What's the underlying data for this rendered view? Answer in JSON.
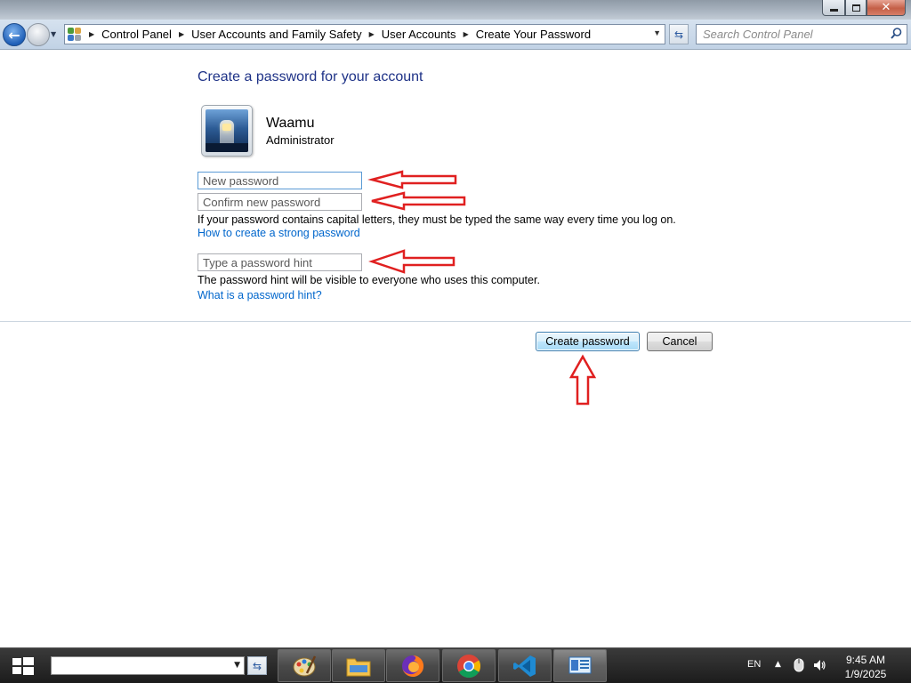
{
  "window": {
    "minimize_icon": "minimize-icon",
    "maximize_icon": "maximize-icon",
    "close_glyph": "✕"
  },
  "nav": {
    "breadcrumbs": [
      "Control Panel",
      "User Accounts and Family Safety",
      "User Accounts",
      "Create Your Password"
    ],
    "search_placeholder": "Search Control Panel"
  },
  "page": {
    "heading": "Create a password for your account",
    "user": {
      "name": "Waamu",
      "role": "Administrator"
    },
    "fields": {
      "new_password": "New password",
      "confirm_password": "Confirm new password",
      "hint": "Type a password hint"
    },
    "caps_note": "If your password contains capital letters, they must be typed the same way every time you log on.",
    "strong_link": "How to create a strong password",
    "hint_note": "The password hint will be visible to everyone who uses this computer.",
    "hint_link": "What is a password hint?",
    "buttons": {
      "create": "Create password",
      "cancel": "Cancel"
    }
  },
  "annotations": {
    "arrow_color": "#e02020"
  },
  "taskbar": {
    "apps": [
      "paint-icon",
      "file-explorer-icon",
      "firefox-icon",
      "chrome-icon",
      "vscode-icon",
      "control-panel-icon"
    ],
    "language": "EN",
    "time": "9:45 AM",
    "date": "1/9/2025"
  }
}
